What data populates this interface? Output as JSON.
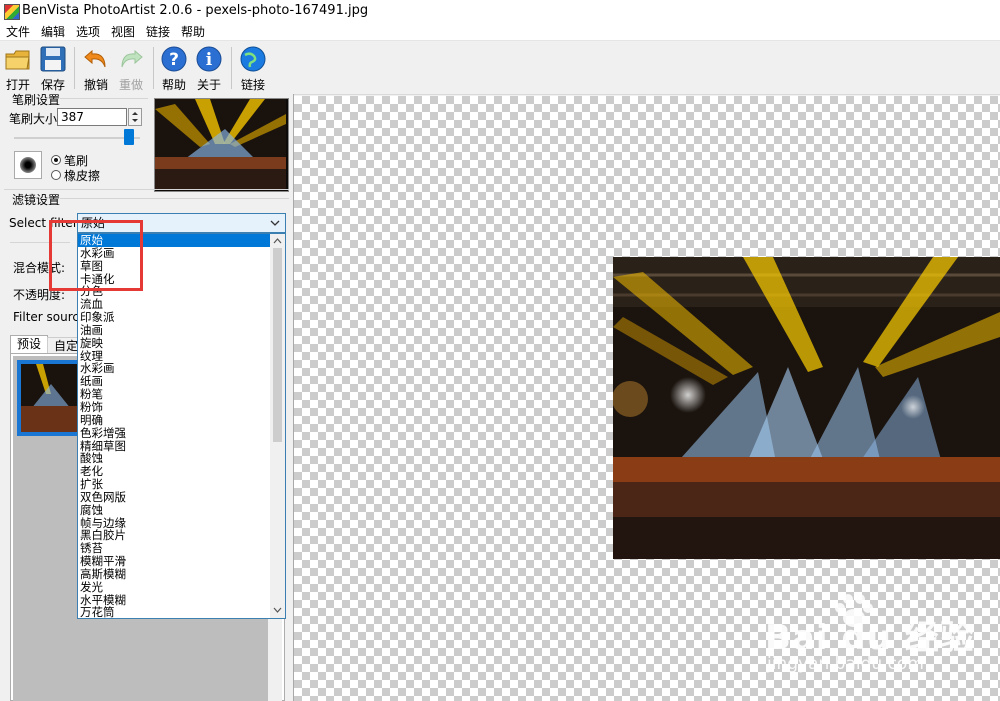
{
  "window": {
    "title": "BenVista PhotoArtist 2.0.6 - pexels-photo-167491.jpg"
  },
  "menu": [
    "文件",
    "编辑",
    "选项",
    "视图",
    "链接",
    "帮助"
  ],
  "toolbar": {
    "open": "打开",
    "save": "保存",
    "undo": "撤销",
    "redo": "重做",
    "help": "帮助",
    "about": "关于",
    "link": "链接"
  },
  "brush": {
    "group_label": "笔刷设置",
    "size_label": "笔刷大小:",
    "size_value": "387",
    "mode_brush": "笔刷",
    "mode_eraser": "橡皮擦",
    "selected_mode": "笔刷"
  },
  "filter": {
    "group_label": "滤镜设置",
    "select_label": "Select filter:",
    "current": "原始",
    "blend_label": "混合模式:",
    "opacity_label": "不透明度:",
    "source_label": "Filter source:",
    "tab_presets": "预设",
    "tab_custom": "自定义",
    "options": [
      "原始",
      "水彩画",
      "草图",
      "卡通化",
      "分色",
      "流血",
      "印象派",
      "油画",
      "旋映",
      "纹理",
      "水彩画",
      "纸画",
      "粉笔",
      "粉饰",
      "明确",
      "色彩增强",
      "精细草图",
      "酸蚀",
      "老化",
      "扩张",
      "双色网版",
      "腐蚀",
      "帧与边缘",
      "黑白胶片",
      "锈苔",
      "模糊平滑",
      "高斯模糊",
      "发光",
      "水平模糊",
      "万花筒"
    ],
    "selected_option": "原始"
  },
  "watermark": {
    "brand": "Bai du 经验",
    "url": "jingyan.baidu.com"
  },
  "colors": {
    "accent": "#0078d7",
    "highlight_box": "#e53935"
  }
}
